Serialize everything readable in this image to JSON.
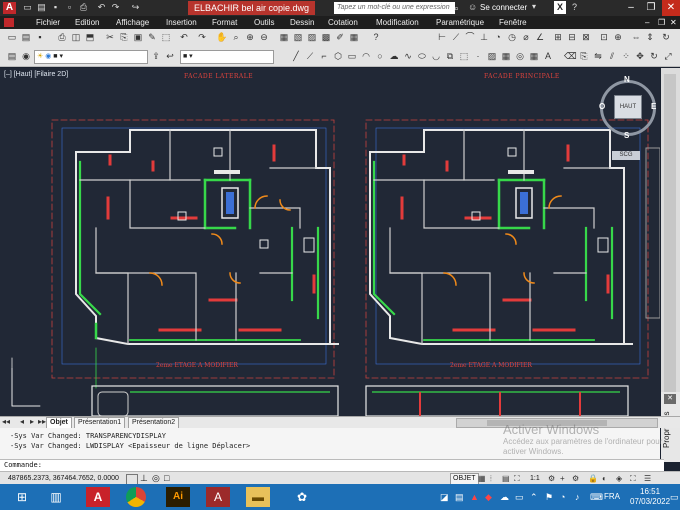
{
  "window": {
    "doc_title": "ELBACHIR bel air copie.dwg",
    "search_placeholder": "Tapez un mot-clé ou une expression",
    "sign_in": "Se connecter"
  },
  "menu": [
    "Fichier",
    "Edition",
    "Affichage",
    "Insertion",
    "Format",
    "Outils",
    "Dessin",
    "Cotation",
    "Modification",
    "Paramétrique",
    "Fenêtre"
  ],
  "viewport": {
    "label": "[–] [Haut] [Filaire 2D]"
  },
  "drawing": {
    "left": {
      "top_title": "FACADE LATERALE",
      "bottom_title": "2eme ETAGE A MODIFIER"
    },
    "right": {
      "top_title": "FACADE PRINCIPALE",
      "bottom_title": "2eme ETAGE A MODIFIER"
    }
  },
  "viewcube": {
    "top": "HAUT",
    "n": "N",
    "s": "S",
    "e": "E",
    "o": "O",
    "scu": "SCG"
  },
  "tabs": [
    "Objet",
    "Présentation1",
    "Présentation2"
  ],
  "command": {
    "lines": [
      "-Sys Var Changed: TRANSPARENCYDISPLAY",
      "-Sys Var Changed: LWDISPLAY <Epaisseur de ligne Déplacer>"
    ],
    "prompt": "Commande:"
  },
  "status": {
    "coords": "487865.2373, 367464.7652, 0.0000",
    "space": "OBJET",
    "scale": "1:1"
  },
  "watermark": {
    "title": "Activer Windows",
    "text": "Accédez aux paramètres de l'ordinateur pour activer Windows."
  },
  "side_panel": "Propriétés",
  "taskbar": {
    "lang": "FRA",
    "time": "16:51",
    "date": "07/03/2022"
  },
  "colors": {
    "canvas": "#212836",
    "walls_white": "#e8e8e8",
    "wall_green": "#37d84a",
    "wall_red": "#e33b3b",
    "accent": "#b7342d"
  }
}
